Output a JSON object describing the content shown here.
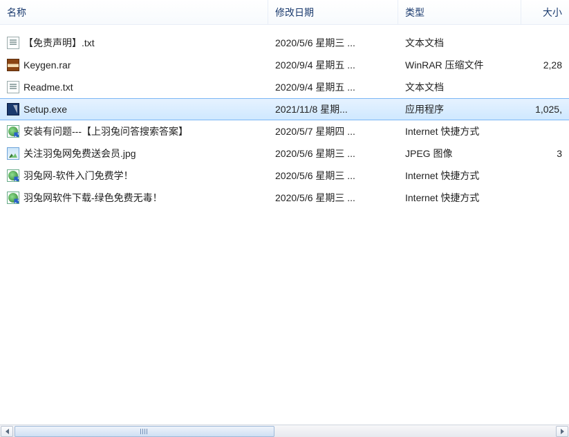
{
  "columns": {
    "name": "名称",
    "modified": "修改日期",
    "type": "类型",
    "size": "大小"
  },
  "files": [
    {
      "name": "【免责声明】.txt",
      "modified": "2020/5/6 星期三 ...",
      "type": "文本文档",
      "size": "",
      "icon": "text-file-icon",
      "selected": false
    },
    {
      "name": "Keygen.rar",
      "modified": "2020/9/4 星期五 ...",
      "type": "WinRAR 压缩文件",
      "size": "2,28",
      "icon": "archive-file-icon",
      "selected": false
    },
    {
      "name": "Readme.txt",
      "modified": "2020/9/4 星期五 ...",
      "type": "文本文档",
      "size": "",
      "icon": "text-file-icon",
      "selected": false
    },
    {
      "name": "Setup.exe",
      "modified": "2021/11/8 星期...",
      "type": "应用程序",
      "size": "1,025,",
      "icon": "application-icon",
      "selected": true
    },
    {
      "name": "安装有问题---【上羽兔问答搜索答案】",
      "modified": "2020/5/7 星期四 ...",
      "type": "Internet 快捷方式",
      "size": "",
      "icon": "internet-shortcut-icon",
      "selected": false
    },
    {
      "name": "关注羽兔网免费送会员.jpg",
      "modified": "2020/5/6 星期三 ...",
      "type": "JPEG 图像",
      "size": "3",
      "icon": "image-file-icon",
      "selected": false
    },
    {
      "name": "羽兔网-软件入门免费学！",
      "modified": "2020/5/6 星期三 ...",
      "type": "Internet 快捷方式",
      "size": "",
      "icon": "internet-shortcut-icon",
      "selected": false
    },
    {
      "name": "羽兔网软件下载-绿色免费无毒！",
      "modified": "2020/5/6 星期三 ...",
      "type": "Internet 快捷方式",
      "size": "",
      "icon": "internet-shortcut-icon",
      "selected": false
    }
  ],
  "colors": {
    "selection_bg_top": "#e6f2ff",
    "selection_bg_bottom": "#cfe8ff",
    "selection_border": "#7ab6f5",
    "header_text": "#1a3a6e"
  }
}
